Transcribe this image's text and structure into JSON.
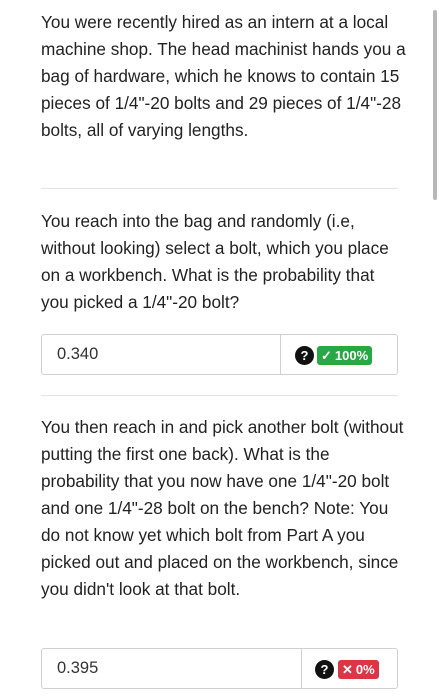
{
  "question": {
    "intro": "You were recently hired as an intern at a local machine shop. The head machinist hands you a bag of hardware, which he knows to contain 15 pieces of 1/4\"-20 bolts and 29 pieces of 1/4\"-28 bolts, all of varying lengths.",
    "part_a": "You reach into the bag and randomly (i.e, without looking) select a bolt, which you place on a workbench. What is the probability that you picked a 1/4\"-20 bolt?",
    "part_b": "You then reach in and pick another bolt (without putting the first one back). What is the probability that you now have one 1/4\"-20 bolt and one 1/4\"-28 bolt on the bench? Note: You do not know yet which bolt from Part A you picked out and placed on the workbench, since you didn't look at that bolt."
  },
  "answers": {
    "part_a": {
      "value": "0.340",
      "help_symbol": "?",
      "badge_mark": "✓",
      "badge_text": "100%",
      "badge_color": "#28a745"
    },
    "part_b": {
      "value": "0.395",
      "help_symbol": "?",
      "badge_mark": "✕",
      "badge_text": "0%",
      "badge_color": "#dc3545"
    }
  },
  "icons": {
    "help": "question-circle-icon",
    "correct": "check-icon",
    "incorrect": "x-icon"
  }
}
